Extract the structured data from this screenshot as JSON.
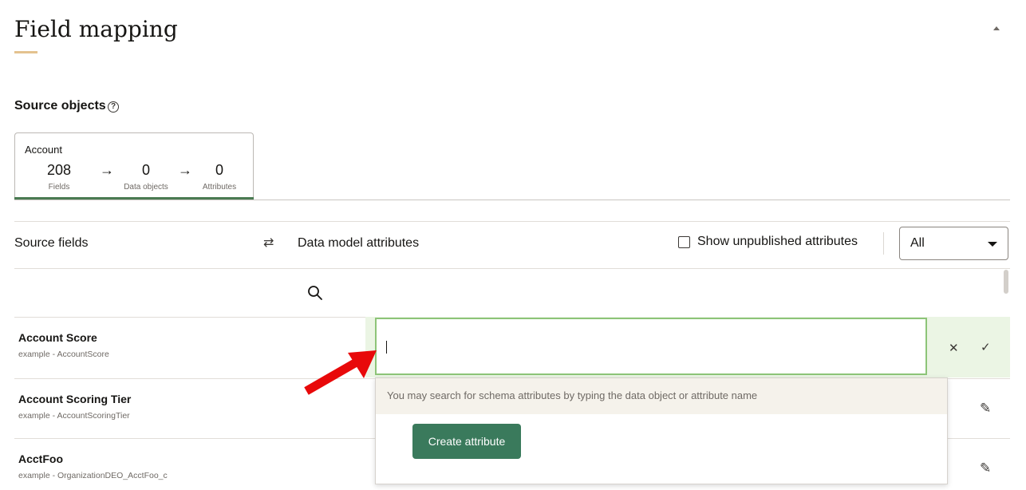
{
  "header": {
    "title": "Field mapping"
  },
  "source_objects": {
    "label": "Source objects",
    "help_icon": "?",
    "card": {
      "name": "Account",
      "fields_count": "208",
      "fields_label": "Fields",
      "data_objects_count": "0",
      "data_objects_label": "Data objects",
      "attributes_count": "0",
      "attributes_label": "Attributes",
      "arrow_glyph": "→"
    }
  },
  "mapping_header": {
    "source_fields": "Source fields",
    "swap_icon": "⇄",
    "data_model_attributes": "Data model attributes",
    "show_unpublished": "Show unpublished attributes",
    "filter_value": "All"
  },
  "rows": [
    {
      "name": "Account Score",
      "sub": "example - AccountScore"
    },
    {
      "name": "Account Scoring Tier",
      "sub": "example - AccountScoringTier"
    },
    {
      "name": "AcctFoo",
      "sub": "example - OrganizationDEO_AcctFoo_c"
    }
  ],
  "editor": {
    "input_value": "",
    "cancel_icon": "✕",
    "confirm_icon": "✓",
    "edit_icon": "✎"
  },
  "dropdown": {
    "hint": "You may search for schema attributes by typing the data object or attribute name",
    "create_label": "Create attribute"
  },
  "colors": {
    "accent_underline": "#e4c28f",
    "active_tab": "#4a7a52",
    "editing_band": "#ebf5e4",
    "input_border": "#8dc478",
    "primary_button": "#3a7a5c",
    "pointer_arrow": "#e8090a"
  }
}
